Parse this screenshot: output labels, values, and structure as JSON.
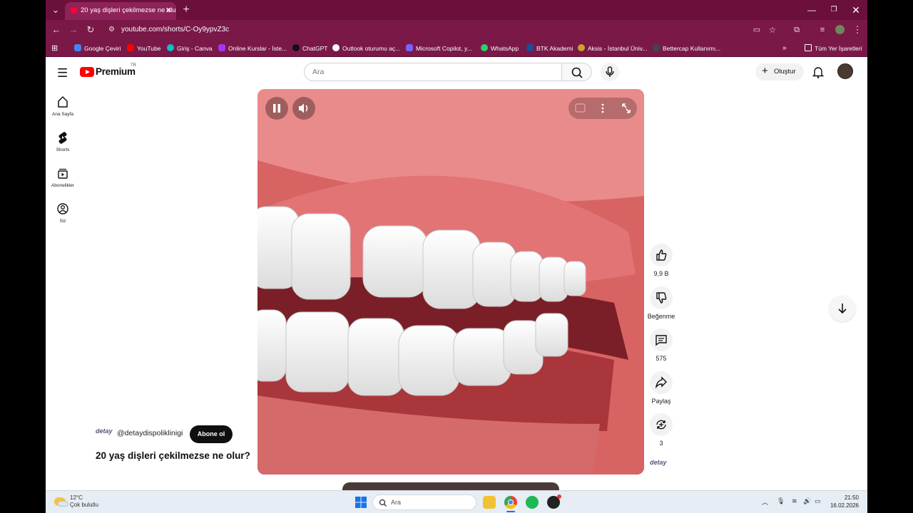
{
  "browser": {
    "tab_title": "20 yaş dişleri çekilmezse ne olur",
    "url": "youtube.com/shorts/C-Oy9ypvZ3c",
    "bookmarks": [
      {
        "label": "Google Çeviri",
        "icon": "translate-icon",
        "color": "#4285f4"
      },
      {
        "label": "YouTube",
        "icon": "youtube-icon",
        "color": "#ff0000"
      },
      {
        "label": "Giriş - Canva",
        "icon": "canva-icon",
        "color": "#00c4cc"
      },
      {
        "label": "Online Kurslar - İste...",
        "icon": "course-icon",
        "color": "#a435f0"
      },
      {
        "label": "ChatGPT",
        "icon": "chatgpt-icon",
        "color": "#111111"
      },
      {
        "label": "Outlook oturumu aç...",
        "icon": "outlook-icon",
        "color": "#ffffff"
      },
      {
        "label": "Microsoft Copilot, y...",
        "icon": "copilot-icon",
        "color": "#7b61ff"
      },
      {
        "label": "WhatsApp",
        "icon": "whatsapp-icon",
        "color": "#25d366"
      },
      {
        "label": "BTK Akademi",
        "icon": "btk-icon",
        "color": "#1e4b9c"
      },
      {
        "label": "Aksis - İstanbul Üniv...",
        "icon": "aksis-icon",
        "color": "#c9a227"
      },
      {
        "label": "Bettercap Kullanımı...",
        "icon": "bettercap-icon",
        "color": "#444444"
      }
    ],
    "all_bookmarks": "Tüm Yer İşaretleri"
  },
  "youtube": {
    "logo_text": "Premium",
    "logo_region": "TR",
    "search_placeholder": "Ara",
    "create_label": "Oluştur",
    "sidebar": [
      {
        "label": "Ana Sayfa",
        "icon": "home-icon"
      },
      {
        "label": "Shorts",
        "icon": "shorts-icon"
      },
      {
        "label": "Abonelikler",
        "icon": "subscriptions-icon"
      },
      {
        "label": "Siz",
        "icon": "you-icon"
      }
    ],
    "short": {
      "channel_handle": "@detaydispoliklinigi",
      "channel_logo_text": "detay",
      "subscribe_label": "Abone ol",
      "title": "20 yaş dişleri çekilmezse ne olur?",
      "likes": "9,9 B",
      "dislike_label": "Beğenme",
      "comments": "575",
      "share_label": "Paylaş",
      "remix_count": "3"
    }
  },
  "taskbar": {
    "temperature": "12°C",
    "weather": "Çok bulutlu",
    "search_placeholder": "Ara",
    "time": "21:50",
    "date": "16.02.2026"
  }
}
